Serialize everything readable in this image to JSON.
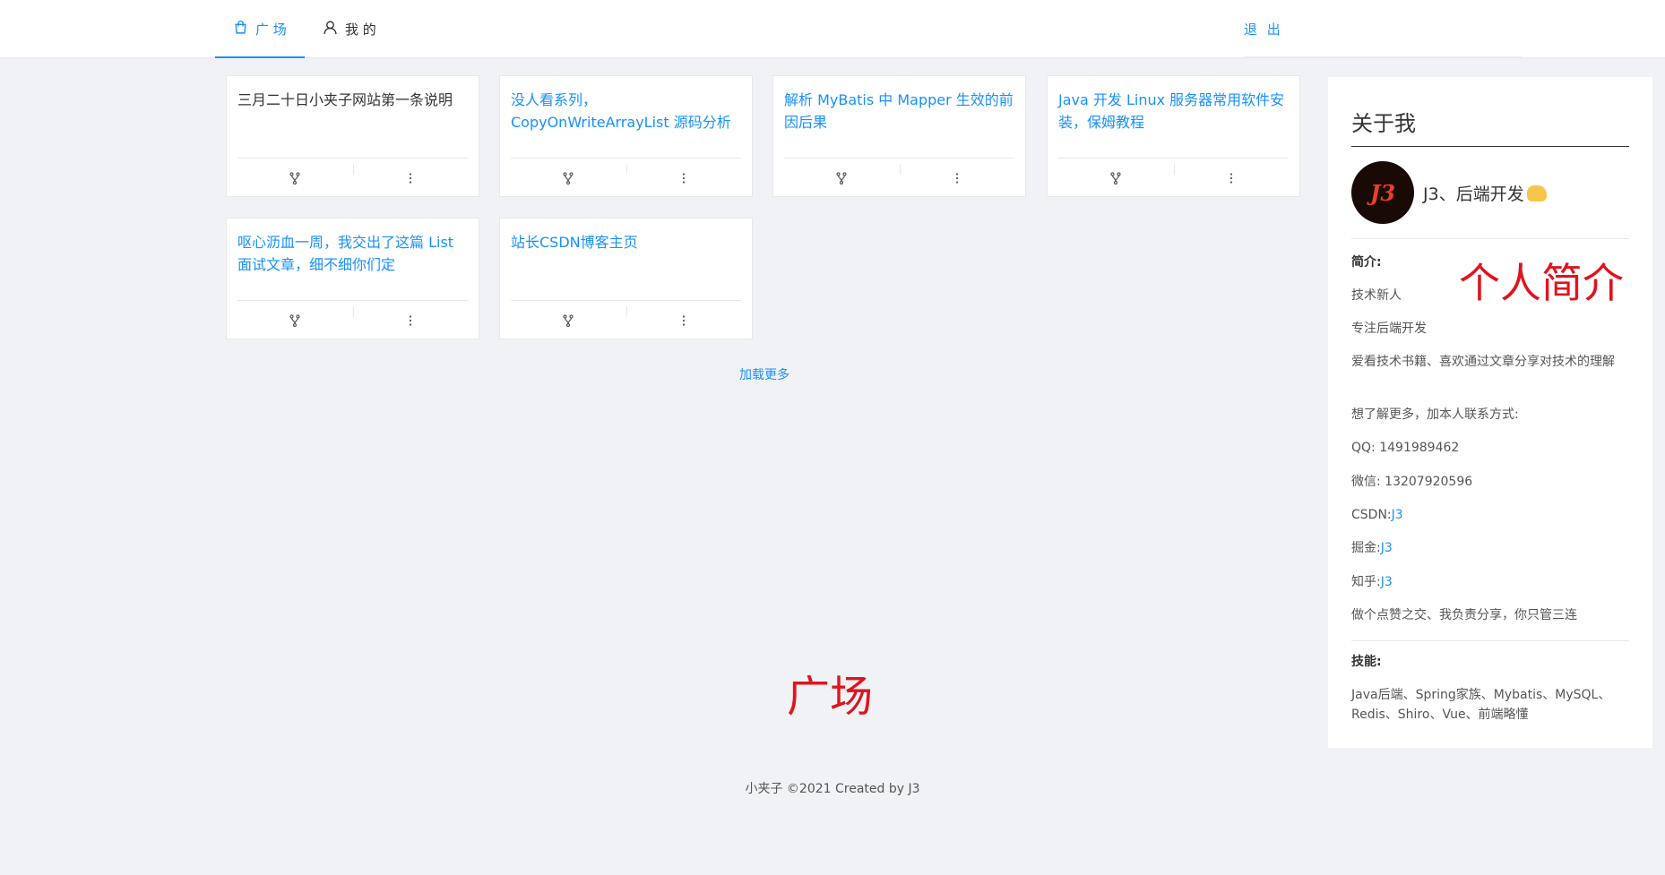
{
  "nav": {
    "tabs": [
      {
        "label": "广 场",
        "icon": "shopping-bag-icon",
        "active": true
      },
      {
        "label": "我 的",
        "icon": "user-icon",
        "active": false
      }
    ],
    "logout_label": "退 出",
    "accent": "#1890ff"
  },
  "cards": [
    {
      "title": "三月二十日小夹子网站第一条说明",
      "link": false
    },
    {
      "title": "没人看系列，CopyOnWriteArrayList 源码分析",
      "link": true
    },
    {
      "title": "解析 MyBatis 中 Mapper 生效的前因后果",
      "link": true
    },
    {
      "title": "Java 开发 Linux 服务器常用软件安装，保姆教程",
      "link": true
    },
    {
      "title": "呕心沥血一周，我交出了这篇 List 面试文章，细不细你们定",
      "link": true
    },
    {
      "title": "站长CSDN博客主页",
      "link": true
    }
  ],
  "card_actions": {
    "fork_icon": "fork-icon",
    "more_icon": "more-vertical-icon"
  },
  "load_more": "加载更多",
  "annotations": {
    "square": "广场",
    "profile": "个人简介"
  },
  "about": {
    "title": "关于我",
    "avatar_text": "J3",
    "author": "J3、后端开发",
    "intro_label": "简介:",
    "intro_lines": [
      "技术新人",
      "专注后端开发",
      "爱看技术书籍、喜欢通过文章分享对技术的理解",
      "想了解更多，加本人联系方式:"
    ],
    "qq_label": "QQ:",
    "qq": "1491989462",
    "wechat_label": "微信:",
    "wechat": "13207920596",
    "csdn_label": "CSDN:",
    "csdn": "J3",
    "juejin_label": "掘金:",
    "juejin": "J3",
    "zhihu_label": "知乎:",
    "zhihu": "J3",
    "slogan": "做个点赞之交、我负责分享，你只管三连",
    "skills_label": "技能:",
    "skills": "Java后端、Spring家族、Mybatis、MySQL、Redis、Shiro、Vue、前端略懂"
  },
  "footer": "小夹子 ©2021 Created by J3"
}
